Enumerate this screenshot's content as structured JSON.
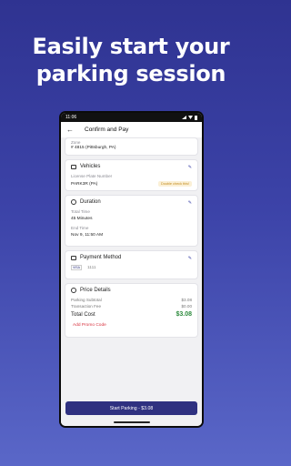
{
  "headline": {
    "line1": "Easily start your",
    "line2": "parking session"
  },
  "status_bar": {
    "time": "11:06"
  },
  "appbar": {
    "back_icon": "back-arrow-icon",
    "title": "Confirm and Pay"
  },
  "location": {
    "label": "Zone",
    "value": "# 4815 (Pittsburgh, PA)"
  },
  "vehicles": {
    "title": "Vehicles",
    "plate_label": "License Plate Number",
    "plate_value": "PARK3R (PA)",
    "badge": "Double check this!"
  },
  "duration": {
    "title": "Duration",
    "total_label": "Total Time",
    "total_value": "45 Minutes",
    "end_label": "End Time",
    "end_value": "Nov 9, 11:50 AM"
  },
  "payment": {
    "title": "Payment Method",
    "card_brand": "VISA",
    "card_last4": "1111"
  },
  "price": {
    "title": "Price Details",
    "subtotal_label": "Parking Subtotal",
    "subtotal_value": "$3.08",
    "fee_label": "Transaction Fee",
    "fee_value": "$0.00",
    "total_label": "Total Cost",
    "total_value": "$3.08",
    "promo_label": "Add Promo Code"
  },
  "cta": {
    "label": "Start Parking - $3.08"
  },
  "colors": {
    "brand": "#2f3180",
    "accent": "#3c43a8",
    "total": "#2c8a3c",
    "promo": "#d8323f"
  }
}
